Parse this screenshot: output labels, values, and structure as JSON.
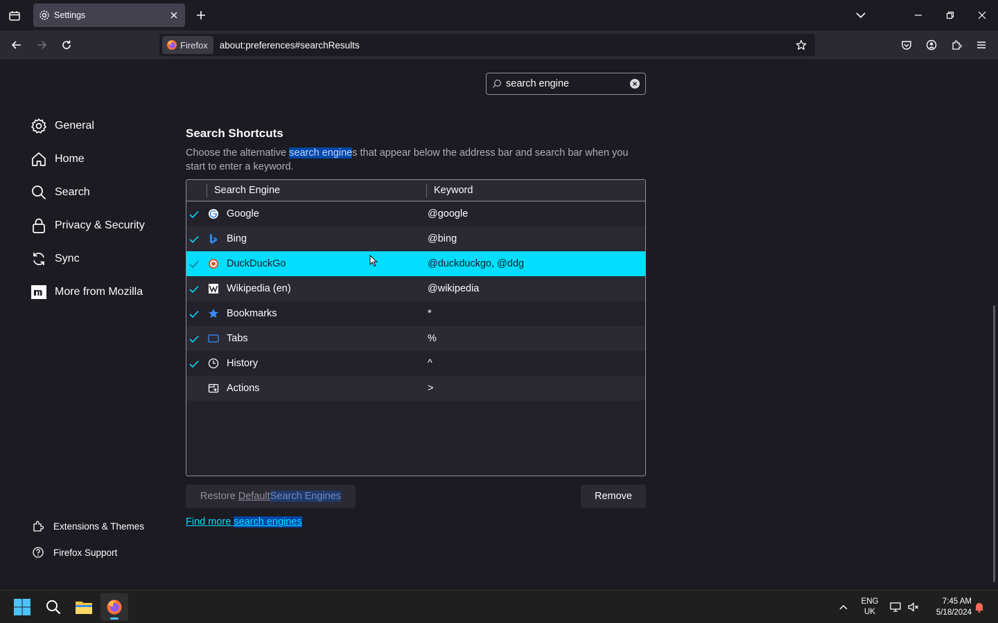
{
  "browser": {
    "tab_title": "Settings",
    "identity_label": "Firefox",
    "url": "about:preferences#searchResults"
  },
  "search": {
    "value": "search engine"
  },
  "sidebar": {
    "items": [
      {
        "label": "General",
        "icon": "gear-icon"
      },
      {
        "label": "Home",
        "icon": "home-icon"
      },
      {
        "label": "Search",
        "icon": "search-icon"
      },
      {
        "label": "Privacy & Security",
        "icon": "lock-icon"
      },
      {
        "label": "Sync",
        "icon": "sync-icon"
      },
      {
        "label": "More from Mozilla",
        "icon": "mozilla-icon"
      }
    ],
    "footer": [
      {
        "label": "Extensions & Themes",
        "icon": "puzzle-icon"
      },
      {
        "label": "Firefox Support",
        "icon": "help-icon"
      }
    ]
  },
  "section": {
    "title": "Search Shortcuts",
    "desc_before": "Choose the alternative ",
    "desc_highlight": "search engine",
    "desc_after": "s that appear below the address bar and search bar when you start to enter a keyword."
  },
  "table": {
    "col_engine": "Search Engine",
    "col_keyword": "Keyword",
    "rows": [
      {
        "name": "Google",
        "keyword": "@google",
        "checked": true,
        "icon": "google-icon"
      },
      {
        "name": "Bing",
        "keyword": "@bing",
        "checked": true,
        "icon": "bing-icon"
      },
      {
        "name": "DuckDuckGo",
        "keyword": "@duckduckgo, @ddg",
        "checked": true,
        "icon": "duckduckgo-icon",
        "selected": true
      },
      {
        "name": "Wikipedia (en)",
        "keyword": "@wikipedia",
        "checked": true,
        "icon": "wikipedia-icon"
      },
      {
        "name": "Bookmarks",
        "keyword": "*",
        "checked": true,
        "icon": "star-icon"
      },
      {
        "name": "Tabs",
        "keyword": "%",
        "checked": true,
        "icon": "tab-icon"
      },
      {
        "name": "History",
        "keyword": "^",
        "checked": true,
        "icon": "clock-icon"
      },
      {
        "name": "Actions",
        "keyword": ">",
        "checked": false,
        "icon": "actions-icon"
      }
    ]
  },
  "buttons": {
    "restore_a": "Restore ",
    "restore_b": "Default ",
    "restore_c": "Search Engines",
    "remove": "Remove",
    "find_more_a": "Find more ",
    "find_more_b": "search engines"
  },
  "taskbar": {
    "lang_1": "ENG",
    "lang_2": "UK",
    "time": "7:45 AM",
    "date": "5/18/2024"
  },
  "colors": {
    "accent": "#00ddff",
    "highlight": "#0047a8",
    "background": "#1c1b22"
  }
}
